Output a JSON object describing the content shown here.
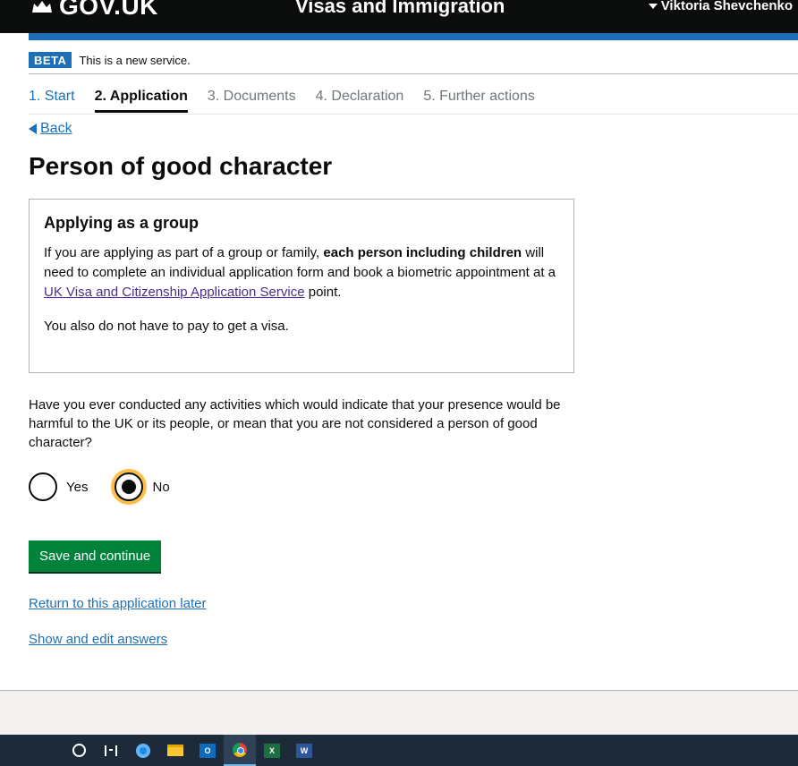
{
  "header": {
    "logo_text": "GOV.UK",
    "service_name": "Visas and Immigration",
    "user_name": "Viktoria Shevchenko"
  },
  "phase_banner": {
    "tag": "BETA",
    "text": "This is a new service."
  },
  "steps": [
    {
      "label": "1. Start",
      "state": "done"
    },
    {
      "label": "2. Application",
      "state": "current"
    },
    {
      "label": "3. Documents",
      "state": "upcoming"
    },
    {
      "label": "4. Declaration",
      "state": "upcoming"
    },
    {
      "label": "5. Further actions",
      "state": "upcoming"
    }
  ],
  "back_link": "Back",
  "page_title": "Person of good character",
  "panel": {
    "heading": "Applying as a group",
    "para1_before": "If you are applying as part of a group or family, ",
    "para1_bold": "each person including children",
    "para1_middle": " will need to complete an individual application form and book a biometric appointment at a ",
    "para1_link": "UK Visa and Citizenship Application Service",
    "para1_after": " point.",
    "para2": "You also do not have to pay to get a visa."
  },
  "question": "Have you ever conducted any activities which would indicate that your presence would be harmful to the UK or its people, or mean that you are not considered a person of good character?",
  "options": [
    {
      "label": "Yes",
      "checked": false
    },
    {
      "label": "No",
      "checked": true
    }
  ],
  "save_button": "Save and continue",
  "links": {
    "return_later": "Return to this application later",
    "show_edit": "Show and edit answers"
  },
  "taskbar": {
    "icons": [
      "cortana-icon",
      "task-view-icon",
      "edge-icon",
      "file-explorer-icon",
      "outlook-icon",
      "chrome-icon",
      "excel-icon",
      "word-icon"
    ],
    "outlook_label": "O",
    "excel_label": "X",
    "word_label": "W"
  },
  "colors": {
    "header": "#0b0c0c",
    "blue": "#1d70b8",
    "green": "#00823b",
    "focus": "#ffbf47"
  }
}
